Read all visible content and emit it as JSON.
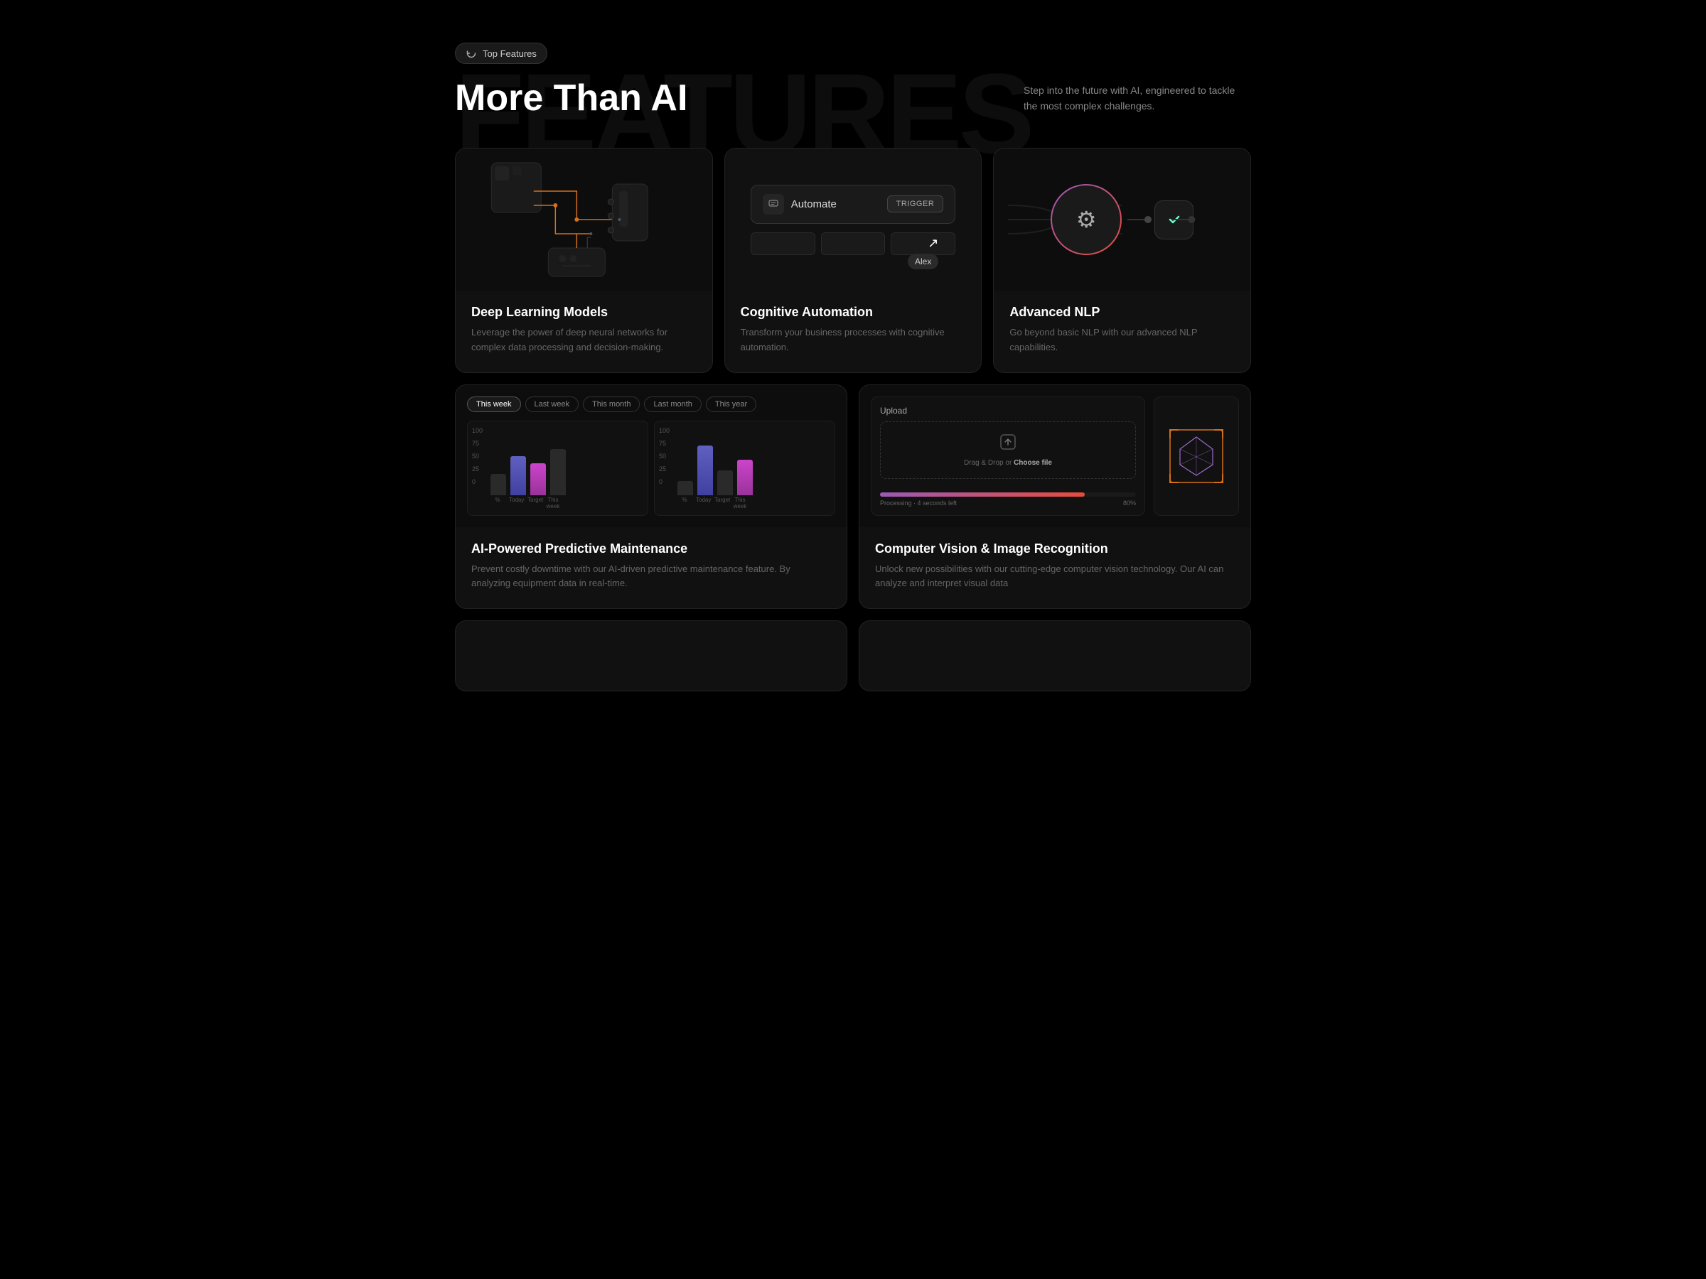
{
  "badge": {
    "label": "Top Features",
    "icon": "refresh-icon"
  },
  "watermark": "FEATURES",
  "heading": "More Than AI",
  "description": "Step into the future with AI, engineered to tackle the most complex challenges.",
  "cards": [
    {
      "id": "deep-learning",
      "title": "Deep Learning Models",
      "desc": "Leverage the power of deep neural networks for complex data processing and decision-making."
    },
    {
      "id": "cognitive-automation",
      "title": "Cognitive Automation",
      "desc": "Transform your business processes with cognitive automation.",
      "automateLabel": "Automate",
      "triggerLabel": "TRIGGER",
      "cursorName": "Alex"
    },
    {
      "id": "advanced-nlp",
      "title": "Advanced NLP",
      "desc": "Go beyond basic NLP with our advanced NLP capabilities."
    },
    {
      "id": "predictive-maintenance",
      "title": "AI-Powered Predictive Maintenance",
      "desc": "Prevent costly downtime with our AI-driven predictive maintenance feature. By analyzing equipment data in real-time.",
      "tabs": [
        "This week",
        "Last week",
        "This month",
        "Last month",
        "This year"
      ],
      "activeTab": "This week",
      "chartXLabels": [
        "%",
        "Today",
        "Target",
        "This week"
      ],
      "chartYLabels": [
        "100",
        "75",
        "50",
        "25",
        "0"
      ]
    },
    {
      "id": "computer-vision",
      "title": "Computer Vision & Image Recognition",
      "desc": "Unlock new possibilities with our cutting-edge computer vision technology. Our AI can analyze and interpret visual data",
      "uploadTitle": "Upload",
      "dropText": "Drag & Drop or",
      "chooseFile": "Choose file",
      "progressText": "Processing · 4 seconds left",
      "progressPct": "80%"
    }
  ]
}
